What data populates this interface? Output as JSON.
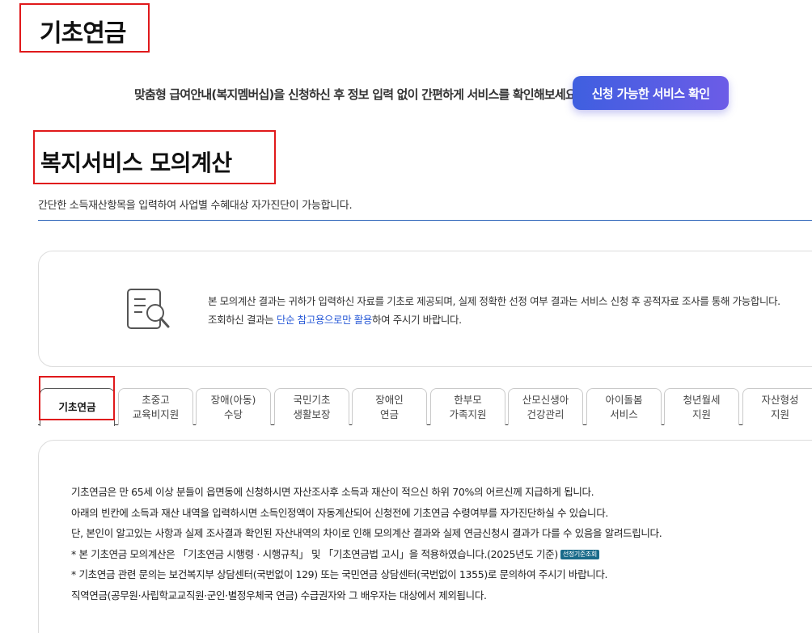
{
  "page_title": "기초연금",
  "promo": {
    "text": "맞춤형 급여안내(복지멤버십)을 신청하신 후 정보 입력 없이 간편하게 서비스를 확인해보세요!",
    "button_label": "신청 가능한 서비스 확인"
  },
  "section": {
    "title": "복지서비스 모의계산",
    "description": "간단한 소득재산항목을 입력하여 사업별 수혜대상 자가진단이 가능합니다."
  },
  "notice": {
    "icon": "document-search-icon",
    "text_before": "본 모의계산 결과는 귀하가 입력하신 자료를 기초로 제공되며, 실제 정확한 선정 여부 결과는 서비스 신청 후 공적자료 조사를 통해 가능합니다. 조회하신 결과는 ",
    "highlight": "단순 참고용으로만 활용",
    "text_after": "하여 주시기 바랍니다."
  },
  "tabs": [
    {
      "line1": "기초연금",
      "line2": ""
    },
    {
      "line1": "초중고",
      "line2": "교육비지원"
    },
    {
      "line1": "장애(아동)",
      "line2": "수당"
    },
    {
      "line1": "국민기초",
      "line2": "생활보장"
    },
    {
      "line1": "장애인",
      "line2": "연금"
    },
    {
      "line1": "한부모",
      "line2": "가족지원"
    },
    {
      "line1": "산모신생아",
      "line2": "건강관리"
    },
    {
      "line1": "아이돌봄",
      "line2": "서비스"
    },
    {
      "line1": "청년월세",
      "line2": "지원"
    },
    {
      "line1": "자산형성",
      "line2": "지원"
    }
  ],
  "content": {
    "lines": [
      "기초연금은 만 65세 이상 분들이 읍면동에 신청하시면 자산조사후 소득과 재산이 적으신 하위 70%의 어르신께 지급하게 됩니다.",
      "아래의 빈칸에 소득과 재산 내역을 입력하시면 소득인정액이 자동계산되어 신청전에 기초연금 수령여부를 자가진단하실 수 있습니다.",
      "단, 본인이 알고있는 사항과 실제 조사결과 확인된 자산내역의 차이로 인해 모의계산 결과와 실제 연금신청시 결과가 다를 수 있음을 알려드립니다.",
      "* 본 기초연금 모의계산은 「기초연금 시행령 · 시행규칙」 및 「기초연금법 고시」을 적용하였습니다.(2025년도 기준)",
      "* 기초연금 관련 문의는 보건복지부 상담센터(국번없이 129) 또는 국민연금 상담센터(국번없이 1355)로 문의하여 주시기 바랍니다.",
      "직역연금(공무원·사립학교교직원·군인·별정우체국 연금) 수급권자와 그 배우자는 대상에서 제외됩니다."
    ],
    "badge_label": "선정기준조회"
  }
}
